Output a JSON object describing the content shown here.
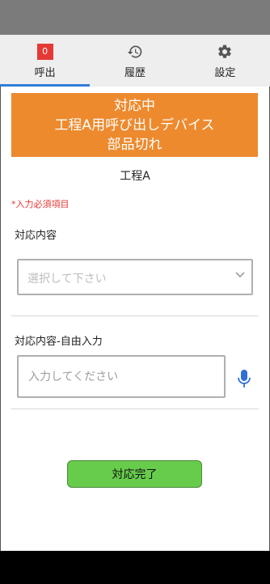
{
  "tabs": [
    {
      "label": "呼出",
      "icon": "call-badge-icon",
      "badge": "0",
      "active": true
    },
    {
      "label": "履歴",
      "icon": "history-icon",
      "active": false
    },
    {
      "label": "設定",
      "icon": "gear-icon",
      "active": false
    }
  ],
  "alert": {
    "status": "対応中",
    "device": "工程A用呼び出しデバイス",
    "reason": "部品切れ",
    "color": "#ed8a2e"
  },
  "process_name": "工程A",
  "required_note": "*入力必須項目",
  "response_content": {
    "label": "対応内容",
    "placeholder": "選択して下さい"
  },
  "free_text": {
    "label": "対応内容-自由入力",
    "placeholder": "入力してください"
  },
  "complete_button": {
    "label": "対応完了",
    "color": "#67cc4c"
  },
  "colors": {
    "accent": "#2f7dd6",
    "required": "#e53935",
    "badge": "#e53935"
  }
}
